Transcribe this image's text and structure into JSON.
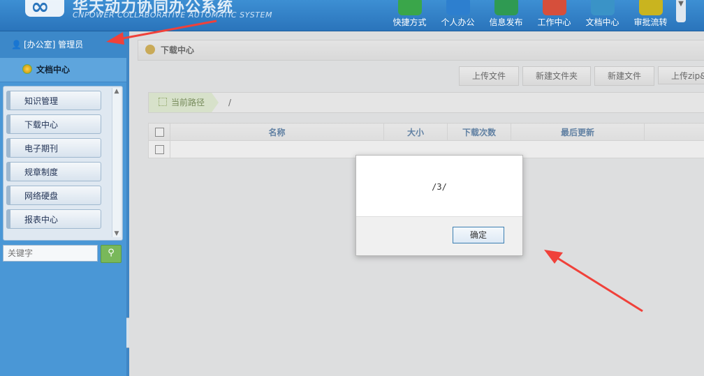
{
  "header": {
    "logo_title": "华天动力协同办公系统",
    "logo_subtitle": "CNPOWER COLLABORATIVE AUTOMATIC SYSTEM",
    "nav": [
      {
        "label": "快捷方式",
        "icon": "paper-plane-icon",
        "color": "#3aa64a"
      },
      {
        "label": "个人办公",
        "icon": "person-icon",
        "color": "#2d7fcf"
      },
      {
        "label": "信息发布",
        "icon": "chat-bubble-icon",
        "color": "#2f9a52"
      },
      {
        "label": "工作中心",
        "icon": "star-icon",
        "color": "#d64f3b"
      },
      {
        "label": "文档中心",
        "icon": "document-icon",
        "color": "#3a93c7"
      },
      {
        "label": "审批流转",
        "icon": "checkmark-icon",
        "color": "#c9b41f"
      }
    ]
  },
  "sidebar": {
    "user": "[办公室] 管理员",
    "section_title": "文档中心",
    "items": [
      {
        "label": "知识管理"
      },
      {
        "label": "下载中心"
      },
      {
        "label": "电子期刊"
      },
      {
        "label": "规章制度"
      },
      {
        "label": "网络硬盘"
      },
      {
        "label": "报表中心"
      }
    ],
    "search_placeholder": "关键字"
  },
  "main": {
    "page_title": "下载中心",
    "toolbar": {
      "upload": "上传文件",
      "new_folder": "新建文件夹",
      "new_file": "新建文件",
      "upload_zip": "上传zip&"
    },
    "path": {
      "label": "当前路径",
      "value": "/"
    },
    "table": {
      "headers": [
        "名称",
        "大小",
        "下载次数",
        "最后更新",
        ""
      ]
    }
  },
  "dialog": {
    "message": "/3/",
    "ok": "确定"
  },
  "colors": {
    "accent_blue": "#2a74bb",
    "arrow_red": "#f0413a"
  }
}
